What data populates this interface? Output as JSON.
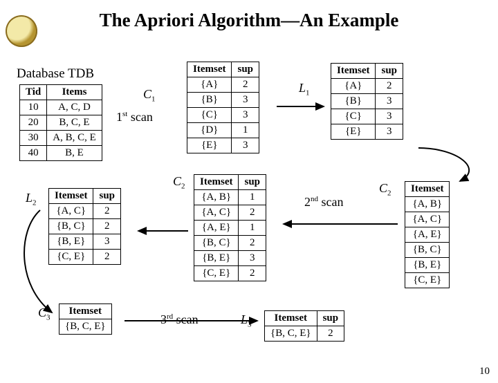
{
  "title": "The Apriori Algorithm—An Example",
  "page_number": "10",
  "database_caption": "Database TDB",
  "labels": {
    "C1": "C",
    "C1_sub": "1",
    "L1": "L",
    "L1_sub": "1",
    "C2a": "C",
    "C2a_sub": "2",
    "C2b": "C",
    "C2b_sub": "2",
    "L2": "L",
    "L2_sub": "2",
    "C3": "C",
    "C3_sub": "3",
    "L3": "L",
    "L3_sub": "3"
  },
  "scans": {
    "s1a": "1",
    "s1b": "st",
    "s1c": " scan",
    "s2a": "2",
    "s2b": "nd",
    "s2c": " scan",
    "s3a": "3",
    "s3b": "rd",
    "s3c": " scan"
  },
  "tdb": {
    "h1": "Tid",
    "h2": "Items",
    "r": [
      {
        "t": "10",
        "i": "A, C, D"
      },
      {
        "t": "20",
        "i": "B, C, E"
      },
      {
        "t": "30",
        "i": "A, B, C, E"
      },
      {
        "t": "40",
        "i": "B, E"
      }
    ]
  },
  "c1": {
    "h1": "Itemset",
    "h2": "sup",
    "r": [
      {
        "i": "{A}",
        "s": "2"
      },
      {
        "i": "{B}",
        "s": "3"
      },
      {
        "i": "{C}",
        "s": "3"
      },
      {
        "i": "{D}",
        "s": "1"
      },
      {
        "i": "{E}",
        "s": "3"
      }
    ]
  },
  "l1": {
    "h1": "Itemset",
    "h2": "sup",
    "r": [
      {
        "i": "{A}",
        "s": "2"
      },
      {
        "i": "{B}",
        "s": "3"
      },
      {
        "i": "{C}",
        "s": "3"
      },
      {
        "i": "{E}",
        "s": "3"
      }
    ]
  },
  "c2sup": {
    "h1": "Itemset",
    "h2": "sup",
    "r": [
      {
        "i": "{A, B}",
        "s": "1"
      },
      {
        "i": "{A, C}",
        "s": "2"
      },
      {
        "i": "{A, E}",
        "s": "1"
      },
      {
        "i": "{B, C}",
        "s": "2"
      },
      {
        "i": "{B, E}",
        "s": "3"
      },
      {
        "i": "{C, E}",
        "s": "2"
      }
    ]
  },
  "c2cand": {
    "h1": "Itemset",
    "r": [
      "{A, B}",
      "{A, C}",
      "{A, E}",
      "{B, C}",
      "{B, E}",
      "{C, E}"
    ]
  },
  "l2": {
    "h1": "Itemset",
    "h2": "sup",
    "r": [
      {
        "i": "{A, C}",
        "s": "2"
      },
      {
        "i": "{B, C}",
        "s": "2"
      },
      {
        "i": "{B, E}",
        "s": "3"
      },
      {
        "i": "{C, E}",
        "s": "2"
      }
    ]
  },
  "c3": {
    "h1": "Itemset",
    "r": [
      "{B, C, E}"
    ]
  },
  "l3": {
    "h1": "Itemset",
    "h2": "sup",
    "r": [
      {
        "i": "{B, C, E}",
        "s": "2"
      }
    ]
  }
}
